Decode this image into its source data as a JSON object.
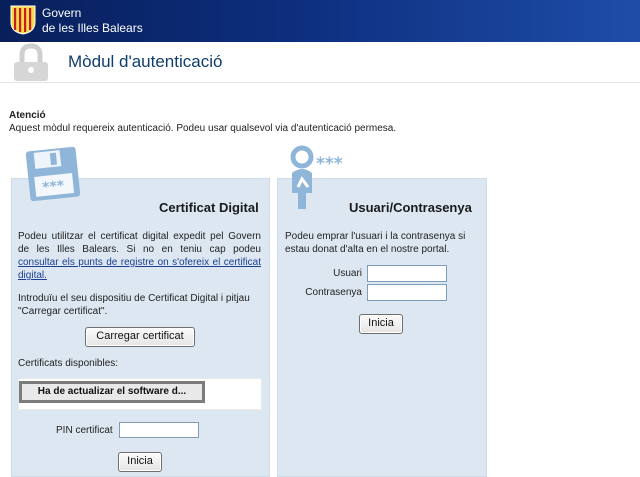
{
  "app": {
    "gov_name_line1": "Govern",
    "gov_name_line2": "de les Illes Balears"
  },
  "header": {
    "title": "Mòdul d'autenticació"
  },
  "notice": {
    "title": "Atenció",
    "text": "Aquest mòdul requereix autenticació. Podeu usar qualsevol via d'autenticació permesa."
  },
  "cert": {
    "title": "Certificat Digital",
    "description": "Podeu utilitzar el certificat digital expedit pel Govern de les Illes Balears. Si no en teniu cap podeu ",
    "link": "consultar els punts de registre on s'ofereix el certificat digital.",
    "instructions": "Introduïu el seu dispositiu de Certificat Digital i pitjau \"Carregar certificat\".",
    "load_button": "Carregar certificat",
    "available_label": "Certificats disponibles:",
    "applet_button": "Ha de actualizar el software d...",
    "pin_label": "PIN certificat",
    "pin_value": "",
    "start_button": "Inicia"
  },
  "user": {
    "title": "Usuari/Contrasenya",
    "description": "Podeu emprar l'usuari i la contrasenya si estau donat d'alta en el nostre portal.",
    "user_label": "Usuari",
    "user_value": "",
    "password_label": "Contrasenya",
    "password_value": "",
    "start_button": "Inicia"
  },
  "icons": {
    "shield": "government-shield-icon",
    "lock": "lock-icon",
    "floppy": "floppy-disk-icon",
    "user": "user-key-icon"
  },
  "colors": {
    "topbar": "#0d2e7d",
    "panel_bg": "#dde7f1",
    "title_blue": "#0f3d6e",
    "icon_blue": "#8fb6d9"
  }
}
